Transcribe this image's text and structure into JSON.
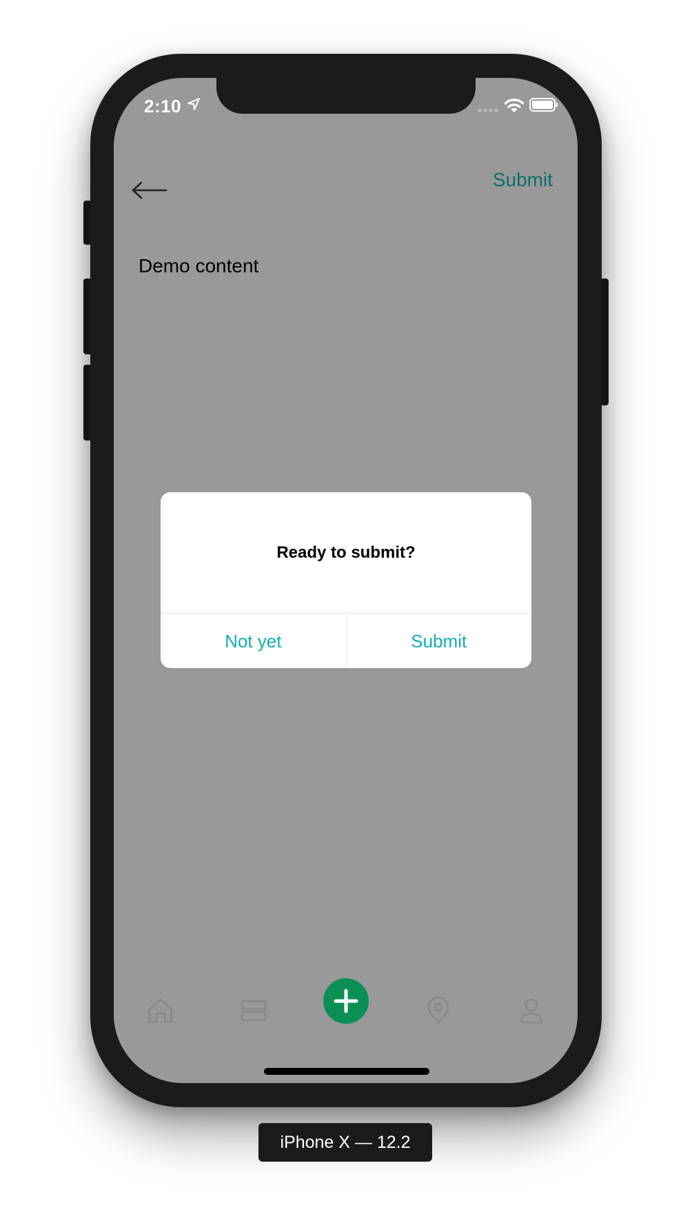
{
  "status_bar": {
    "time": "2:10"
  },
  "header": {
    "back_icon": "arrow-left-icon",
    "submit_label": "Submit"
  },
  "content": {
    "text": "Demo content"
  },
  "alert": {
    "title": "Ready to submit?",
    "cancel_label": "Not yet",
    "confirm_label": "Submit"
  },
  "tabbar": {
    "items": [
      {
        "icon": "home-icon"
      },
      {
        "icon": "feed-icon"
      },
      {
        "icon": "plus-icon"
      },
      {
        "icon": "location-pin-icon"
      },
      {
        "icon": "profile-icon"
      }
    ]
  },
  "device_label": "iPhone X — 12.2",
  "colors": {
    "accent_teal": "#14adb3",
    "header_link": "#0f6e6e",
    "fab_green": "#0c8f55",
    "overlay_gray": "#999999",
    "frame": "#1b1b1b"
  }
}
